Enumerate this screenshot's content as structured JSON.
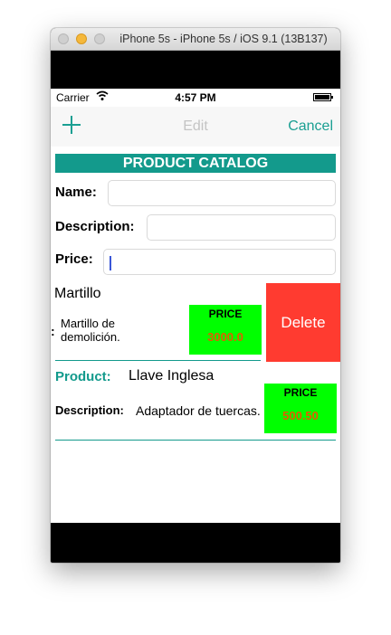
{
  "window": {
    "title": "iPhone 5s - iPhone 5s / iOS 9.1 (13B137)"
  },
  "status_bar": {
    "carrier": "Carrier",
    "time": "4:57 PM"
  },
  "nav": {
    "add_icon": "plus-icon",
    "edit_label": "Edit",
    "cancel_label": "Cancel"
  },
  "catalog": {
    "header": "PRODUCT CATALOG"
  },
  "form": {
    "name_label": "Name:",
    "name_value": "",
    "description_label": "Description:",
    "description_value": "",
    "price_label": "Price:",
    "price_value": ""
  },
  "products": [
    {
      "name": "Martillo",
      "colon": ":",
      "description": "Martillo de demolición.",
      "price_label": "PRICE",
      "price": "3000.0",
      "delete_label": "Delete"
    },
    {
      "product_label": "Product:",
      "name": "Llave Inglesa",
      "description_label": "Description:",
      "description": "Adaptador de tuercas.",
      "price_label": "PRICE",
      "price": "500.50"
    }
  ],
  "colors": {
    "accent": "#139a8c",
    "price_bg": "#00ff00",
    "price_text": "#e25c00",
    "delete": "#ff3b30"
  }
}
